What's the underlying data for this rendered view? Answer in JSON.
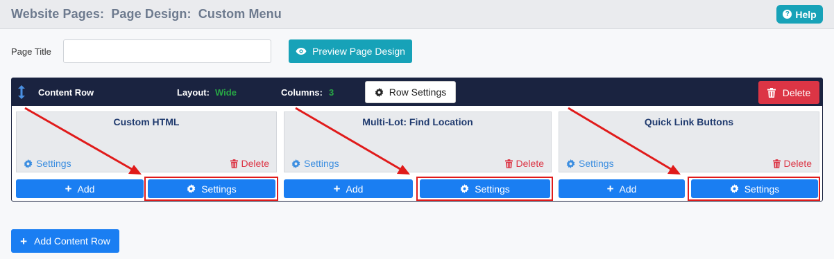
{
  "header": {
    "title": "Website Pages:  Page Design:  Custom Menu",
    "help_label": "Help",
    "help_icon": "question-circle-icon"
  },
  "form": {
    "page_title_label": "Page Title",
    "page_title_value": "",
    "preview_label": "Preview Page Design"
  },
  "content_row": {
    "title": "Content Row",
    "layout_label": "Layout:",
    "layout_value": "Wide",
    "columns_label": "Columns:",
    "columns_value": "3",
    "row_settings_label": "Row Settings",
    "delete_label": "Delete",
    "columns": [
      {
        "title": "Custom HTML",
        "settings_link": "Settings",
        "delete_link": "Delete",
        "add_label": "Add",
        "settings_button": "Settings"
      },
      {
        "title": "Multi-Lot: Find Location",
        "settings_link": "Settings",
        "delete_link": "Delete",
        "add_label": "Add",
        "settings_button": "Settings"
      },
      {
        "title": "Quick Link Buttons",
        "settings_link": "Settings",
        "delete_link": "Delete",
        "add_label": "Add",
        "settings_button": "Settings"
      }
    ]
  },
  "add_content_row_label": "Add Content Row",
  "colors": {
    "navy": "#1a2340",
    "primary": "#1a7ef2",
    "info": "#17a2b8",
    "danger": "#dc3545",
    "success": "#28a745",
    "annotation": "#e01b1b"
  }
}
